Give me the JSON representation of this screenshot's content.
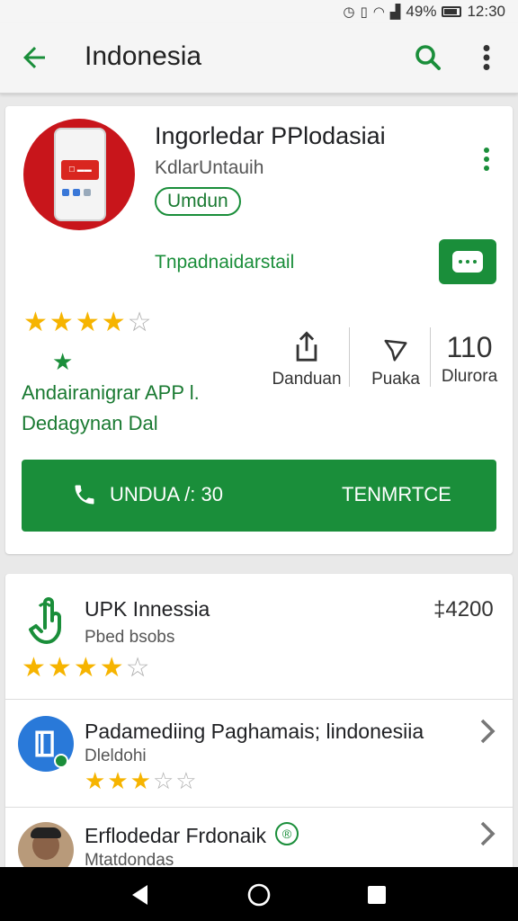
{
  "status_bar": {
    "battery": "49%",
    "time": "12:30"
  },
  "app_bar": {
    "title": "Indonesia"
  },
  "featured_app": {
    "name": "Ingorledar PPlodasiai",
    "developer": "KdlarUntauih",
    "install_chip": "Umdun",
    "subtitle": "Tnpadnaidarstail",
    "rating": 4,
    "info_line1": "Andairanigrar APP l.",
    "info_line2": "Dedagynan Dal",
    "stats": [
      {
        "label": "Danduan",
        "icon": "share-icon"
      },
      {
        "label": "Puaka",
        "icon": "send-icon"
      },
      {
        "value": "110",
        "label": "Dlurora"
      }
    ],
    "primary_button_left": "UNDUA /: 30",
    "primary_button_right": "TENMRTCE",
    "brand_color": "#1a8e3a"
  },
  "list": [
    {
      "title": "UPK Innessia",
      "subtitle": "Pbed bsobs",
      "price": "‡4200",
      "rating": 4,
      "icon": "touch-gesture-icon"
    },
    {
      "title": "Padamediing Paghamais; lindonesiia",
      "subtitle": "Dleldohi",
      "rating": 3,
      "icon": "book-icon"
    },
    {
      "title": "Erflodedar Frdonaik",
      "subtitle": "Mtatdondas",
      "badge": "®",
      "icon": "avatar"
    }
  ]
}
